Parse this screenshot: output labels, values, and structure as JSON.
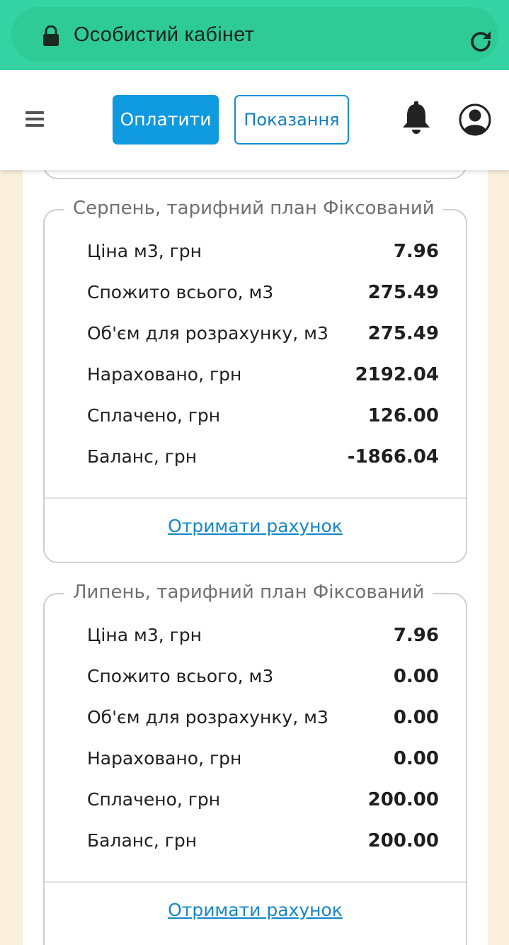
{
  "browser": {
    "url_title": "Особистий кабінет",
    "lock_icon": "lock-icon",
    "reload_icon": "reload-icon"
  },
  "header": {
    "menu_icon": "hamburger-menu-icon",
    "pay_label": "Оплатити",
    "readings_label": "Показання",
    "bell_icon": "bell-icon",
    "user_icon": "user-account-icon",
    "accent": "#0f9ae0"
  },
  "cards": [
    {
      "title": "Серпень, тарифний план Фіксований",
      "rows": [
        {
          "label": "Ціна м3, грн",
          "value": "7.96"
        },
        {
          "label": "Спожито всього, м3",
          "value": "275.49"
        },
        {
          "label": "Об'єм для розрахунку, м3",
          "value": "275.49"
        },
        {
          "label": "Нараховано, грн",
          "value": "2192.04"
        },
        {
          "label": "Сплачено, грн",
          "value": "126.00"
        },
        {
          "label": "Баланс, грн",
          "value": "-1866.04"
        }
      ],
      "link": "Отримати рахунок"
    },
    {
      "title": "Липень, тарифний план Фіксований",
      "rows": [
        {
          "label": "Ціна м3, грн",
          "value": "7.96"
        },
        {
          "label": "Спожито всього, м3",
          "value": "0.00"
        },
        {
          "label": "Об'єм для розрахунку, м3",
          "value": "0.00"
        },
        {
          "label": "Нараховано, грн",
          "value": "0.00"
        },
        {
          "label": "Сплачено, грн",
          "value": "200.00"
        },
        {
          "label": "Баланс, грн",
          "value": "200.00"
        }
      ],
      "link": "Отримати рахунок"
    }
  ]
}
